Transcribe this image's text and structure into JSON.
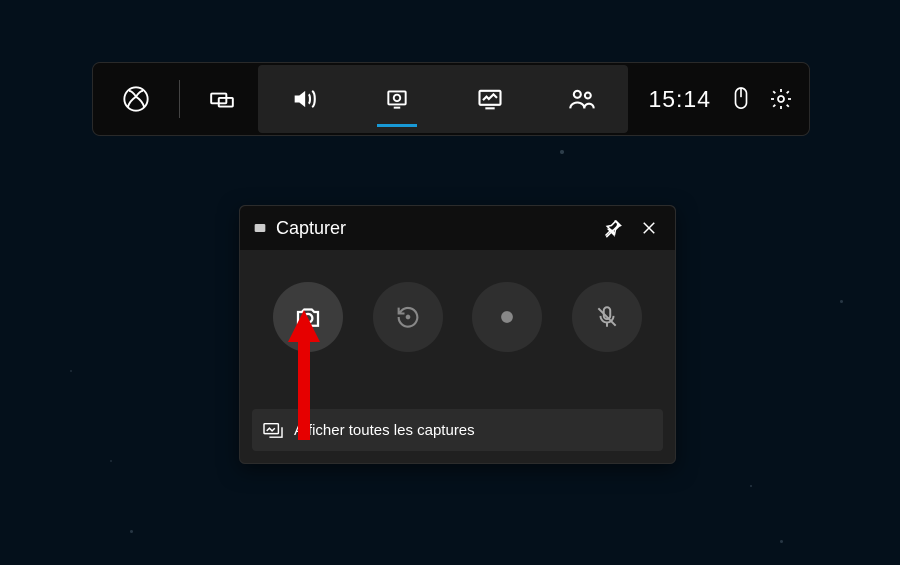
{
  "gamebar": {
    "time": "15:14",
    "buttons": {
      "xbox": "xbox-icon",
      "widgets": "widgets-icon",
      "audio": "audio-icon",
      "capture": "capture-icon",
      "performance": "performance-icon",
      "social": "social-icon",
      "mouse": "mouse-icon",
      "settings": "settings-icon"
    },
    "active": "capture"
  },
  "capture_window": {
    "title": "Capturer",
    "buttons": {
      "screenshot": "camera-icon",
      "record_last": "record-last-icon",
      "record": "record-icon",
      "mic_toggle": "mic-off-icon"
    },
    "footer_label": "Afficher toutes les captures",
    "titlebar": {
      "pin": "pin-icon",
      "close": "close-icon"
    }
  },
  "annotation": {
    "pointer": "red-arrow"
  }
}
